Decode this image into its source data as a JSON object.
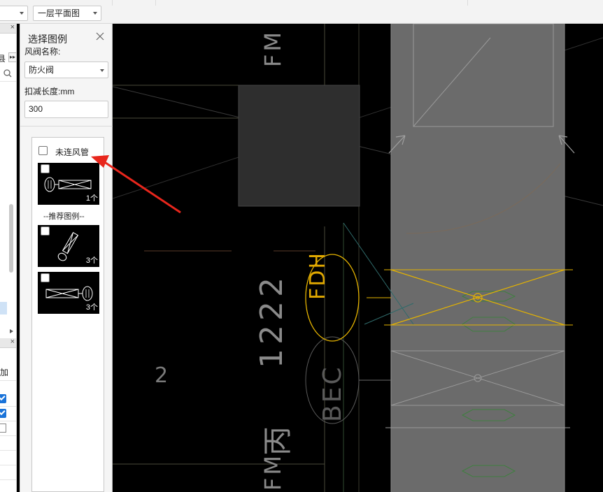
{
  "toolbar": {
    "floor_select": "一层平面图"
  },
  "left_strip": {
    "partial_button_text": "县",
    "add_label": "加",
    "partial_text_1": "i"
  },
  "legend_panel": {
    "title": "选择图例",
    "damper_name_label": "风阀名称:",
    "damper_name_value": "防火阀",
    "deduct_length_label": "扣减长度:mm",
    "deduct_length_value": "300",
    "unconnected_duct_label": "未连风管",
    "recommended_header": "--推荐图例--",
    "tiles": [
      {
        "count": "1个"
      },
      {
        "count": "3个"
      },
      {
        "count": "3个"
      }
    ]
  },
  "canvas": {
    "fdh_label": "FDH",
    "cad_texts": {
      "fm_top": "FM",
      "fm_bottom": "FM",
      "num_1222": "1222",
      "char_bing": "丙",
      "bec": "BEC",
      "num_2": "2"
    }
  },
  "colors": {
    "cad_background": "#000000",
    "duct_fill": "#6b6b6b",
    "selected_damper": "#e5b300",
    "annotation_arrow": "#e8261c"
  }
}
